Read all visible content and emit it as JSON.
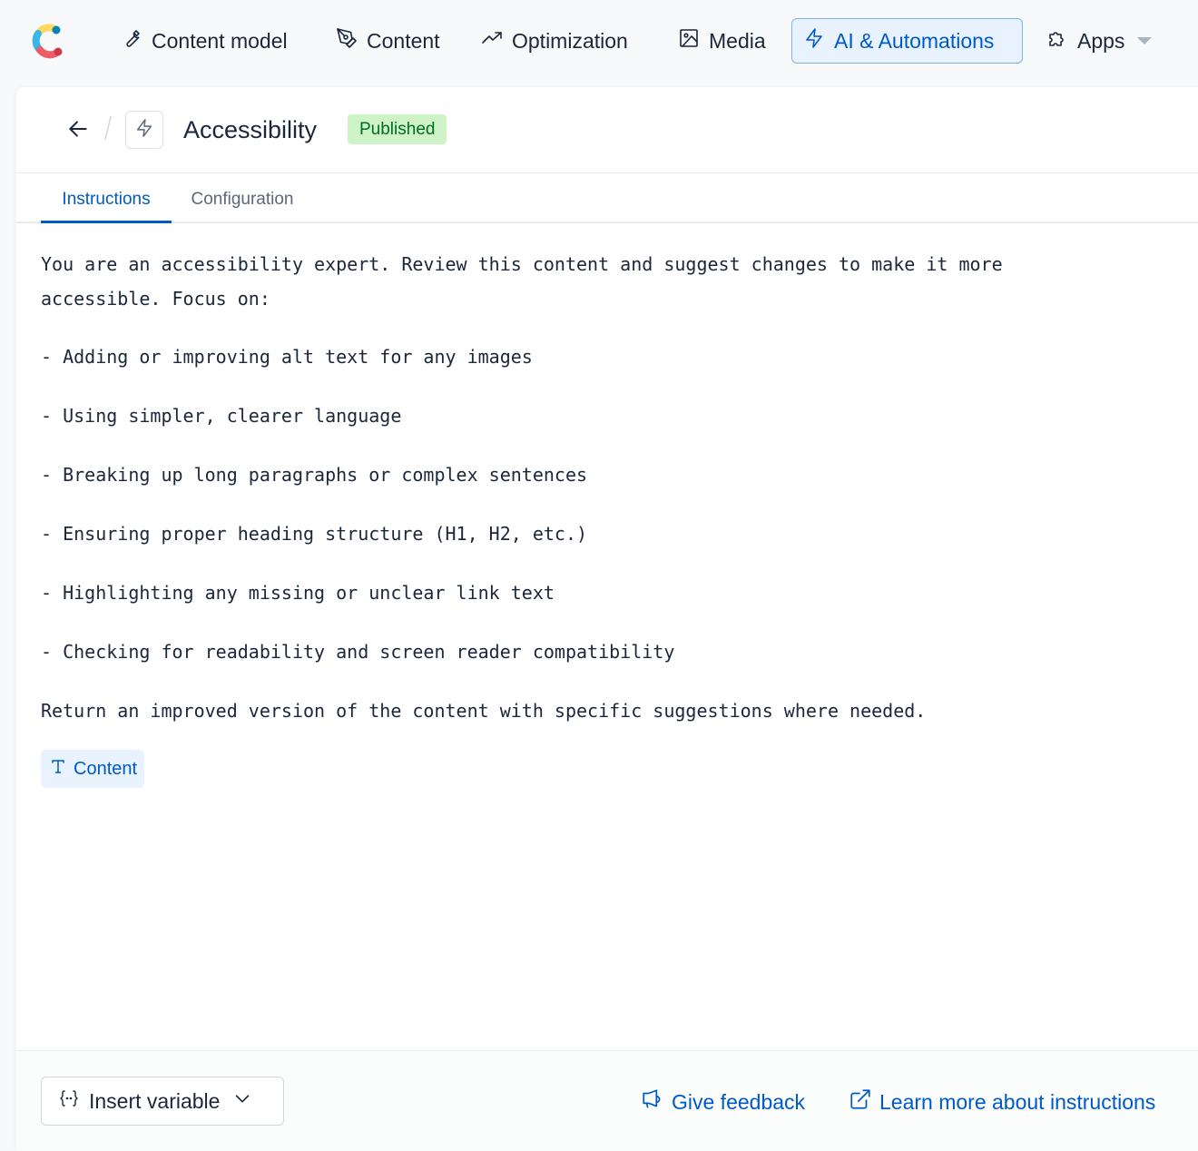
{
  "nav": {
    "items": [
      {
        "label": "Content model",
        "icon": "wrench-icon"
      },
      {
        "label": "Content",
        "icon": "pen-nib-icon"
      },
      {
        "label": "Optimization",
        "icon": "trend-up-icon"
      },
      {
        "label": "Media",
        "icon": "image-icon"
      },
      {
        "label": "AI & Automations",
        "icon": "lightning-icon",
        "active": true
      },
      {
        "label": "Apps",
        "icon": "puzzle-icon"
      }
    ]
  },
  "header": {
    "title": "Accessibility",
    "status": "Published"
  },
  "tabs": [
    {
      "label": "Instructions",
      "active": true
    },
    {
      "label": "Configuration",
      "active": false
    }
  ],
  "instructions": {
    "intro": "You are an accessibility expert. Review this content and suggest changes to make it more accessible. Focus on:",
    "bullets": [
      "- Adding or improving alt text for any images",
      "- Using simpler, clearer language",
      "- Breaking up long paragraphs or complex sentences",
      "- Ensuring proper heading structure (H1, H2, etc.)",
      "- Highlighting any missing or unclear link text",
      "- Checking for readability and screen reader compatibility"
    ],
    "closing": "Return an improved version of the content with specific suggestions where needed."
  },
  "variable_chip": {
    "label": "Content",
    "icon": "text-type-icon"
  },
  "footer": {
    "insert_variable": "Insert variable",
    "give_feedback": "Give feedback",
    "learn_more": "Learn more about instructions"
  },
  "colors": {
    "accent": "#0059c8",
    "active_bg": "#e8f3ff",
    "badge_bg": "#cdf3c6",
    "badge_text": "#006d23"
  }
}
